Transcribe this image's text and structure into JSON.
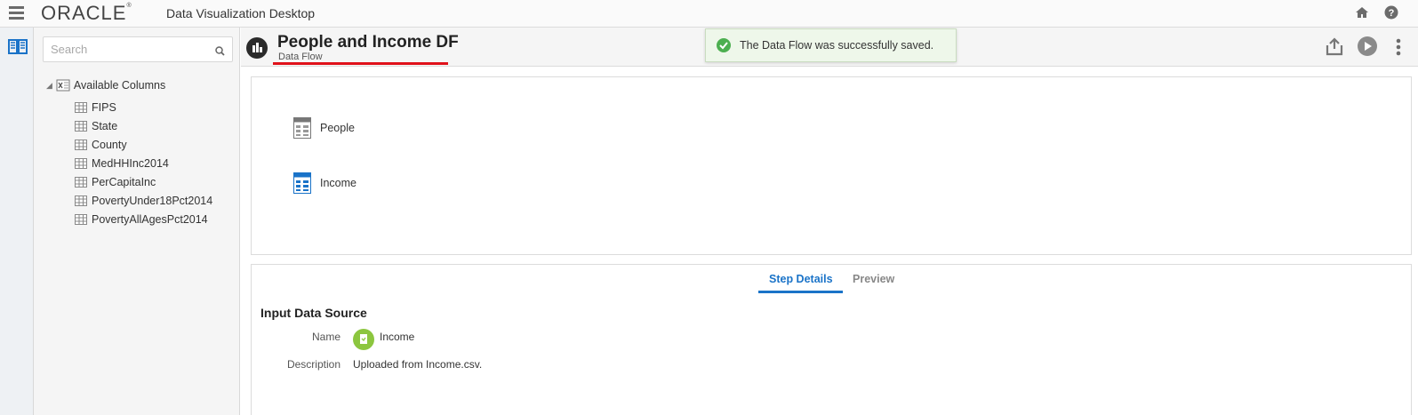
{
  "topbar": {
    "brand": "ORACLE",
    "app_title": "Data Visualization Desktop"
  },
  "left_panel": {
    "search_placeholder": "Search",
    "tree_root": "Available Columns",
    "columns": [
      "FIPS",
      "State",
      "County",
      "MedHHInc2014",
      "PerCapitaInc",
      "PovertyUnder18Pct2014",
      "PovertyAllAgesPct2014"
    ]
  },
  "header": {
    "title": "People and Income DF",
    "subtitle": "Data Flow",
    "toast": "The Data Flow was successfully saved."
  },
  "canvas": {
    "nodes": [
      {
        "label": "People"
      },
      {
        "label": "Income"
      }
    ]
  },
  "details": {
    "tabs": [
      "Step Details",
      "Preview"
    ],
    "section_title": "Input Data Source",
    "name_label": "Name",
    "name_value": "Income",
    "description_label": "Description",
    "description_value": "Uploaded from Income.csv."
  },
  "colors": {
    "accent": "#1a73c8",
    "title_underline": "#e0121b",
    "toast_bg": "#eef7ea",
    "success": "#4caf50"
  }
}
